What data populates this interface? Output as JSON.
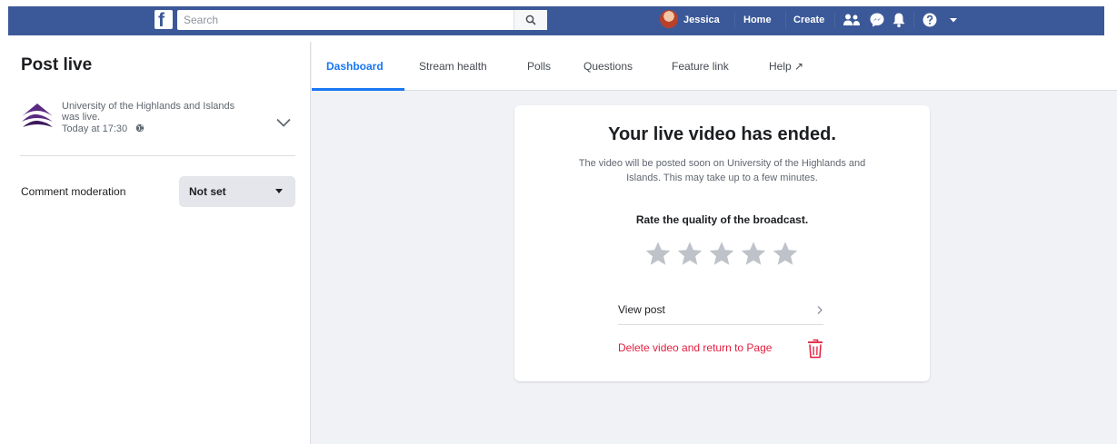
{
  "nav": {
    "search_placeholder": "Search",
    "user_name": "Jessica",
    "home_label": "Home",
    "create_label": "Create",
    "icons": [
      "facebook-icon",
      "search-icon",
      "friends-icon",
      "messenger-icon",
      "notifications-icon",
      "help-icon",
      "dropdown-icon"
    ],
    "colors": {
      "brand": "#3b5998"
    }
  },
  "sidebar": {
    "title": "Post live",
    "page_line1": "University of the Highlands and Islands",
    "page_line2": "was live.",
    "time": "Today at 17:30",
    "moderation_label": "Comment moderation",
    "moderation_value": "Not set"
  },
  "tabs": [
    {
      "label": "Dashboard",
      "active": true
    },
    {
      "label": "Stream health",
      "active": false
    },
    {
      "label": "Polls",
      "active": false
    },
    {
      "label": "Questions",
      "active": false
    },
    {
      "label": "Feature link",
      "active": false
    },
    {
      "label": "Help ↗",
      "active": false
    }
  ],
  "card": {
    "title": "Your live video has ended.",
    "desc_line1": "The video will be posted soon on University of the Highlands and",
    "desc_line2": "Islands. This may take up to a few minutes.",
    "rate_label": "Rate the quality of the broadcast.",
    "rating": {
      "value": 0,
      "max": 5
    },
    "view_post_label": "View post",
    "delete_label": "Delete video and return to Page"
  },
  "colors": {
    "accent": "#1877f2",
    "danger": "#e41e3f",
    "star_empty": "#bec3c9"
  }
}
